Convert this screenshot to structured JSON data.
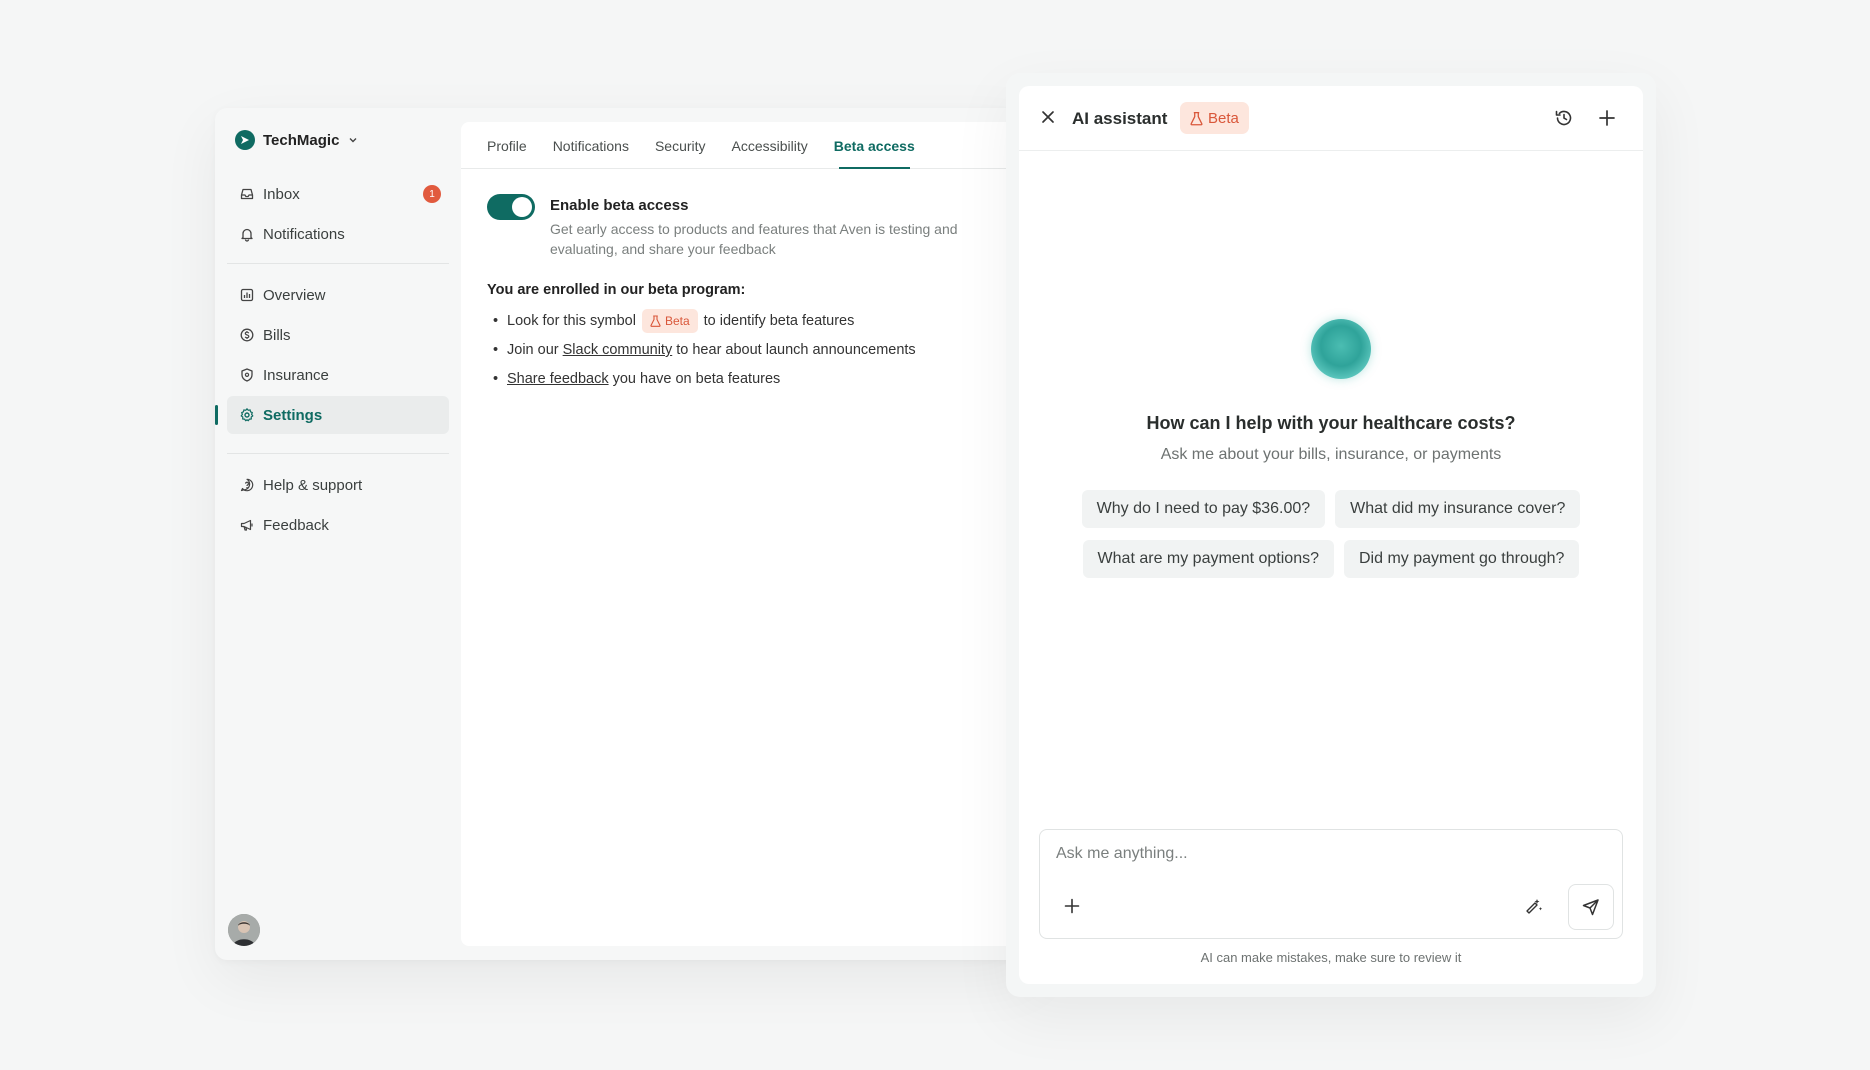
{
  "app": {
    "brand": "TechMagic",
    "nav_primary": [
      {
        "label": "Inbox",
        "icon": "inbox-icon",
        "badge": "1"
      },
      {
        "label": "Notifications",
        "icon": "bell-icon"
      }
    ],
    "nav_main": [
      {
        "label": "Overview",
        "icon": "chart-icon"
      },
      {
        "label": "Bills",
        "icon": "dollar-circle-icon"
      },
      {
        "label": "Insurance",
        "icon": "shield-icon"
      },
      {
        "label": "Settings",
        "icon": "gear-icon",
        "active": true
      }
    ],
    "nav_footer": [
      {
        "label": "Help & support",
        "icon": "help-icon"
      },
      {
        "label": "Feedback",
        "icon": "megaphone-icon"
      }
    ],
    "accent_color": "#0f6b62",
    "badge_color": "#e15a3e"
  },
  "settings": {
    "tabs": [
      "Profile",
      "Notifications",
      "Security",
      "Accessibility",
      "Beta access"
    ],
    "active_tab": "Beta access",
    "toggle_title": "Enable beta access",
    "toggle_on": true,
    "toggle_desc": "Get early access to products and features that Aven is testing and evaluating, and share your feedback",
    "enrolled_title": "You are enrolled in our beta program:",
    "bullet1_pre": "Look for this symbol",
    "bullet1_chip": "Beta",
    "bullet1_post": "to identify beta features",
    "bullet2_pre": "Join our",
    "bullet2_link": "Slack community",
    "bullet2_post": "to hear about launch announcements",
    "bullet3_link": "Share feedback",
    "bullet3_post": "you have on beta features"
  },
  "assistant": {
    "title": "AI assistant",
    "beta_label": "Beta",
    "heading": "How can I help with your healthcare costs?",
    "subheading": "Ask me about your bills, insurance, or payments",
    "suggestions": [
      "Why do I need to pay $36.00?",
      "What did my insurance cover?",
      "What are my payment options?",
      "Did my payment go through?"
    ],
    "input_placeholder": "Ask me anything...",
    "disclaimer": "AI can make mistakes, make sure to review it",
    "beta_bg": "#fde6dd",
    "beta_fg": "#d9573a"
  }
}
